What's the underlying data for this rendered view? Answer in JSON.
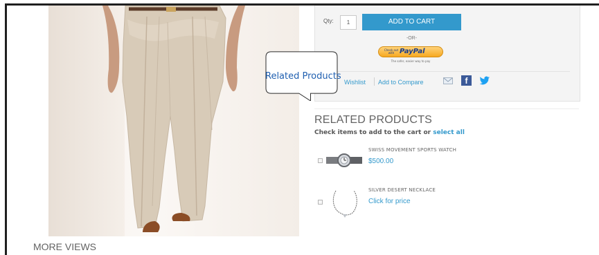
{
  "product": {
    "qty_label": "Qty:",
    "qty_value": "1",
    "add_to_cart_label": "ADD TO CART",
    "or_label": "-OR-",
    "paypal": {
      "checkout_text": "Check out with",
      "brand": "PayPal",
      "tagline": "The safer, easier way to pay"
    },
    "links": {
      "wishlist": "Wishlist",
      "compare": "Add to Compare"
    },
    "share_icons": [
      "email-icon",
      "facebook-icon",
      "twitter-icon"
    ]
  },
  "related": {
    "title": "RELATED PRODUCTS",
    "subtitle_prefix": "Check items to add to the cart or ",
    "select_all": "select all",
    "items": [
      {
        "name": "SWISS MOVEMENT SPORTS WATCH",
        "price": "$500.00",
        "icon": "watch-thumbnail"
      },
      {
        "name": "SILVER DESERT NECKLACE",
        "price": "Click for price",
        "icon": "necklace-thumbnail"
      }
    ]
  },
  "gallery": {
    "more_views": "MORE VIEWS"
  },
  "callout": {
    "text": "Related Products"
  },
  "colors": {
    "accent": "#3399cc",
    "text": "#636363",
    "facebook": "#3b5998",
    "twitter": "#1da1f2"
  }
}
